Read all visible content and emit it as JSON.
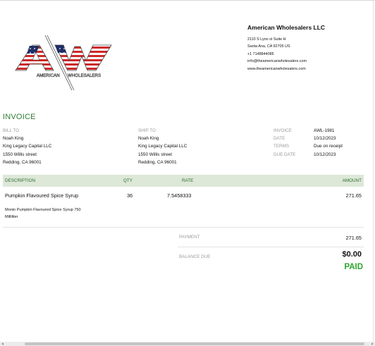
{
  "logo": {
    "mark_text": "AW",
    "wordmark_left": "AMERICAN",
    "wordmark_right": "WHOLESALERS",
    "colors": {
      "red": "#cc2a2a",
      "navy": "#1f2f66",
      "white": "#ffffff",
      "outline": "#444444"
    }
  },
  "company": {
    "name": "American Wholesalers LLC",
    "address_line1": "2110 S Lyon st Suite H",
    "address_line2": "Santa Ana,  CA  92705 US",
    "phone": "+1 7148844085",
    "email": "info@theamericanwholesalers.com",
    "website": "www.theamericanwholesalers.com"
  },
  "invoice_title": "INVOICE",
  "bill_to": {
    "heading": "BILL TO",
    "name": "Noah King",
    "company": "King Legacy Capital LLC",
    "street": "1550 Willis street",
    "city": "Redding, CA  96001"
  },
  "ship_to": {
    "heading": "SHIP TO",
    "name": "Noah King",
    "company": "King Legacy Capital LLC",
    "street": "1550 Willis street",
    "city": "Redding, CA  96001"
  },
  "meta": [
    {
      "label": "INVOICE",
      "value": "AWL-1981"
    },
    {
      "label": "DATE",
      "value": "10/12/2023"
    },
    {
      "label": "TERMS",
      "value": "Due on receipt"
    },
    {
      "label": "DUE DATE",
      "value": "10/12/2023"
    }
  ],
  "table": {
    "headers": {
      "description": "DESCRIPTION",
      "qty": "QTY",
      "rate": "RATE",
      "amount": "AMOUNT"
    },
    "items": [
      {
        "name": "Pumpkin Flavoured Spice Syrup",
        "detail": "Monin Pumpkin Flavoured Spice Syrup 750 Milliliter",
        "qty": "36",
        "rate": "7.5458333",
        "amount": "271.65"
      }
    ]
  },
  "totals": {
    "payment_label": "PAYMENT",
    "payment_value": "271.65",
    "balance_label": "BALANCE DUE",
    "balance_value": "$0.00",
    "status": "PAID"
  },
  "accent_colors": {
    "title_green": "#2e7d32",
    "header_bar": "#dde8d8",
    "paid_green": "#2ea52e"
  }
}
